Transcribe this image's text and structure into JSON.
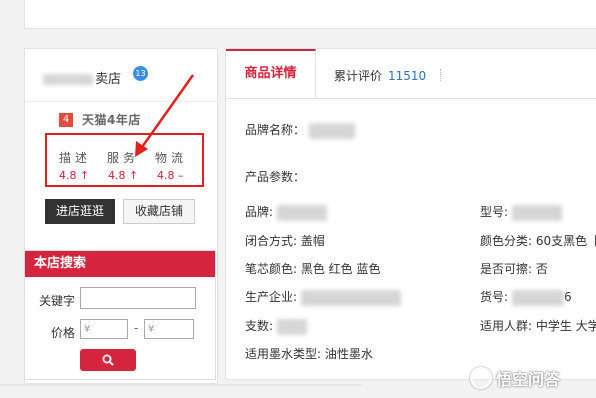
{
  "shop": {
    "name_suffix": "卖店",
    "badge": "13",
    "tmall_years_num": "4",
    "tmall_years_label": "天猫4年店"
  },
  "ratings": {
    "labels": [
      "描述",
      "服务",
      "物流"
    ],
    "values": [
      "4.8 ↑",
      "4.8 ↑",
      "4.8 –"
    ]
  },
  "buttons": {
    "enter_shop": "进店逛逛",
    "favorite_shop": "收藏店铺"
  },
  "store_search": {
    "title": "本店搜索",
    "keyword_label": "关键字",
    "keyword_value": "",
    "price_label": "价格",
    "price_from_placeholder": "¥",
    "price_dash": "-",
    "price_to_placeholder": "¥",
    "search_icon": "search-icon"
  },
  "tabs": {
    "detail": "商品详情",
    "reviews_label": "累计评价",
    "reviews_count": "11510"
  },
  "details": {
    "brand_name_label": "品牌名称：",
    "params_label": "产品参数：",
    "brand_label": "品牌:",
    "model_label": "型号:",
    "closure_label": "闭合方式: 盖帽",
    "color_class_label": "颜色分类: 60支黑色【",
    "ink_color_label": "笔芯颜色: 黑色 红色 蓝色",
    "erasable_label": "是否可擦: 否",
    "manufacturer_label": "生产企业:",
    "item_no_label": "货号:",
    "item_no_suffix": "6",
    "count_label": "支数:",
    "audience_label": "适用人群: 中学生 大学",
    "ink_type_label": "适用墨水类型: 油性墨水"
  },
  "watermark": {
    "text": "悟空问答"
  },
  "colors": {
    "accent": "#d5253e",
    "highlight_box": "#e0211d",
    "link": "#2d74b9"
  }
}
